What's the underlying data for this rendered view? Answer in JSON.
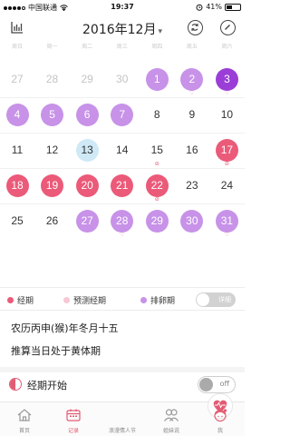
{
  "status_bar": {
    "carrier": "中国联通",
    "time": "19:37",
    "battery": "41%",
    "battery_level": 0.41
  },
  "header": {
    "month_title": "2016年12月"
  },
  "weekdays": [
    "周日",
    "周一",
    "周二",
    "周三",
    "周四",
    "周五",
    "周六"
  ],
  "calendar": {
    "rows": [
      [
        {
          "n": "27",
          "s": "muted"
        },
        {
          "n": "28",
          "s": "muted"
        },
        {
          "n": "29",
          "s": "muted"
        },
        {
          "n": "30",
          "s": "muted"
        },
        {
          "n": "1",
          "s": "ovu"
        },
        {
          "n": "2",
          "s": "ovu",
          "m": "heart"
        },
        {
          "n": "3",
          "s": "ovu-dark",
          "m": "heart"
        }
      ],
      [
        {
          "n": "4",
          "s": "ovu"
        },
        {
          "n": "5",
          "s": "ovu"
        },
        {
          "n": "6",
          "s": "ovu"
        },
        {
          "n": "7",
          "s": "ovu"
        },
        {
          "n": "8",
          "s": ""
        },
        {
          "n": "9",
          "s": ""
        },
        {
          "n": "10",
          "s": ""
        }
      ],
      [
        {
          "n": "11",
          "s": ""
        },
        {
          "n": "12",
          "s": ""
        },
        {
          "n": "13",
          "s": "today"
        },
        {
          "n": "14",
          "s": ""
        },
        {
          "n": "15",
          "s": "",
          "m": "ban"
        },
        {
          "n": "16",
          "s": ""
        },
        {
          "n": "17",
          "s": "per",
          "m": "ban"
        }
      ],
      [
        {
          "n": "18",
          "s": "per"
        },
        {
          "n": "19",
          "s": "per"
        },
        {
          "n": "20",
          "s": "per"
        },
        {
          "n": "21",
          "s": "per"
        },
        {
          "n": "22",
          "s": "per",
          "m": "ban"
        },
        {
          "n": "23",
          "s": ""
        },
        {
          "n": "24",
          "s": ""
        }
      ],
      [
        {
          "n": "25",
          "s": ""
        },
        {
          "n": "26",
          "s": ""
        },
        {
          "n": "27",
          "s": "ovu"
        },
        {
          "n": "28",
          "s": "ovu",
          "m": "heart"
        },
        {
          "n": "29",
          "s": "ovu"
        },
        {
          "n": "30",
          "s": "ovu"
        },
        {
          "n": "31",
          "s": "ovu",
          "m": "heart"
        }
      ]
    ]
  },
  "legend": {
    "period": "经期",
    "predicted": "预测经期",
    "ovulation": "排卵期",
    "detail_toggle": "详细",
    "colors": {
      "period": "#eb5a79",
      "predicted": "#f8c7d4",
      "ovulation": "#c792e8"
    }
  },
  "info": {
    "lunar": "农历丙申(猴)年冬月十五",
    "phase": "推算当日处于黄体期"
  },
  "period_start": {
    "label": "经期开始",
    "toggle": "off"
  },
  "tabs": [
    {
      "label": "首页",
      "icon": "home-icon"
    },
    {
      "label": "记录",
      "icon": "calendar-icon"
    },
    {
      "label": "浪漫情人节",
      "icon": "heart-icon"
    },
    {
      "label": "姐妹说",
      "icon": "sisters-icon"
    },
    {
      "label": "我",
      "icon": "profile-icon"
    }
  ]
}
